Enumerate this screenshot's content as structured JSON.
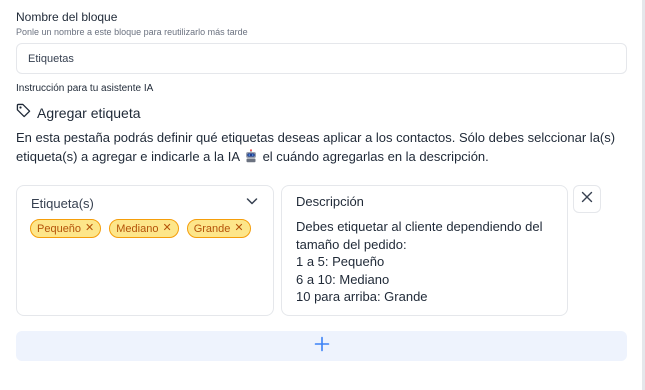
{
  "block_name": {
    "label": "Nombre del bloque",
    "hint": "Ponle un nombre a este bloque para reutilizarlo más tarde",
    "value": "Etiquetas"
  },
  "ai_instruction": {
    "label": "Instrucción para tu asistente IA"
  },
  "section": {
    "icon": "tag-icon",
    "title": "Agregar etiqueta",
    "description_before_icon": "En esta pestaña podrás definir qué etiquetas deseas aplicar a los contactos. Sólo debes selccionar la(s) etiqueta(s) a agregar e indicarle a la IA",
    "inline_icon": "robot-icon",
    "description_after_icon": "el cuándo agregarlas en la descripción."
  },
  "tags_select": {
    "label": "Etiqueta(s)",
    "chips": [
      {
        "label": "Pequeño"
      },
      {
        "label": "Mediano"
      },
      {
        "label": "Grande"
      }
    ]
  },
  "description": {
    "title": "Descripción",
    "text": "Debes etiquetar al cliente dependiendo del tamaño del pedido:\n1 a 5: Pequeño\n6 a 10: Mediano\n10 para arriba: Grande"
  },
  "colors": {
    "chip_bg": "#fde68a",
    "chip_border": "#f59e0b",
    "chip_text": "#b45309",
    "add_button_bg": "#eef3fd",
    "accent": "#3b82f6"
  }
}
